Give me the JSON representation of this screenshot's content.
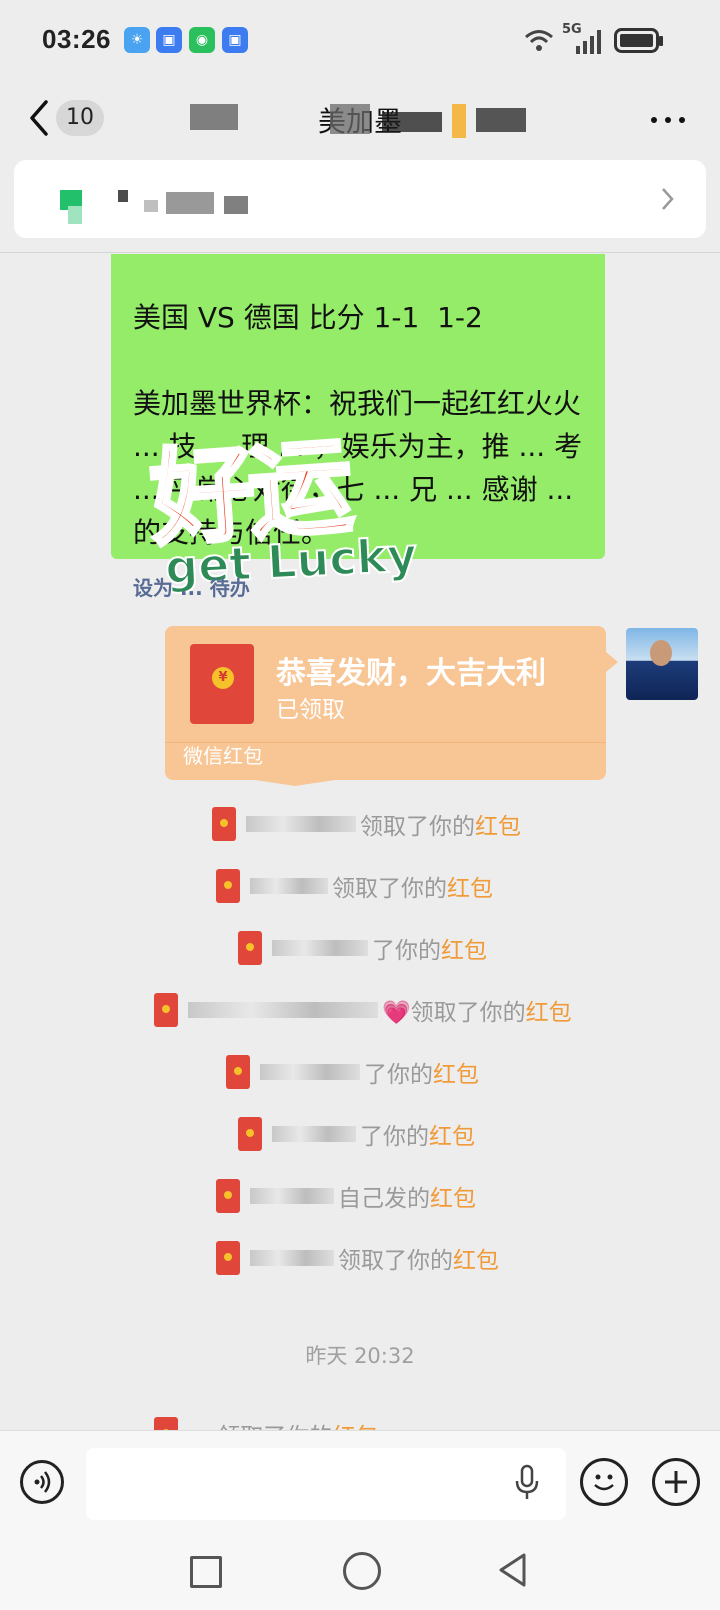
{
  "status_bar": {
    "time": "03:26",
    "network": "5G",
    "app_icons": [
      "weather-icon",
      "security-icon",
      "wechat-icon",
      "security-icon"
    ]
  },
  "header": {
    "unread_count": "10",
    "title": "美加墨"
  },
  "pinned_notice": {},
  "message": {
    "text": "美国 VS 德国 比分 1-1  1-2\n\n美加墨世界杯：祝我们一起红红火火 ... 技 ... 理 ... ，娱乐为主，推 ... 考 ... 平常心对待，七 ... 兄 ... 感谢 ... 的支持与信任。",
    "todo_link": "设为 ... 待办",
    "sticker_main": "好运",
    "sticker_sub": "get Lucky"
  },
  "red_packet": {
    "greeting": "恭喜发财，大吉大利",
    "status": "已领取",
    "brand": "微信红包"
  },
  "notices": [
    {
      "suffix": "领取了你的",
      "highlight": "红包"
    },
    {
      "suffix": "领取了你的",
      "highlight": "红包"
    },
    {
      "suffix": "了你的",
      "highlight": "红包"
    },
    {
      "suffix": "💗领取了你的",
      "highlight": "红包"
    },
    {
      "suffix": "了你的",
      "highlight": "红包"
    },
    {
      "suffix": "了你的",
      "highlight": "红包"
    },
    {
      "suffix": "自己发的",
      "highlight": "红包"
    },
    {
      "suffix": "领取了你的",
      "highlight": "红包"
    }
  ],
  "timestamp": "昨天 20:32",
  "partial_notice": {
    "text": "... 领取了你的",
    "highlight": "红包"
  },
  "input_bar": {
    "placeholder": ""
  },
  "colors": {
    "bubble_green": "#95ec69",
    "red_packet": "#f8c595",
    "highlight": "#f09a39",
    "link": "#576b95"
  }
}
